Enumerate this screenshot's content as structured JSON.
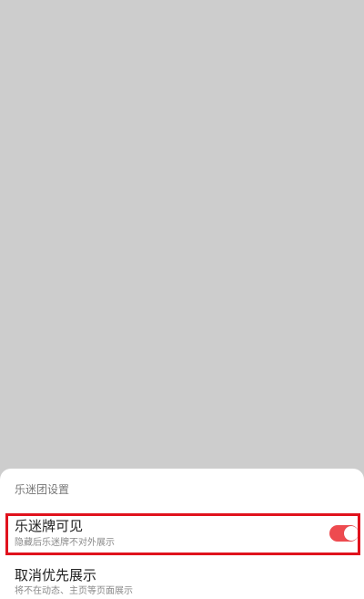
{
  "sheet": {
    "title": "乐迷团设置"
  },
  "settings": [
    {
      "label": "乐迷牌可见",
      "description": "隐藏后乐迷牌不对外展示",
      "toggle": {
        "state": "on",
        "color": "#ee4a4f"
      }
    },
    {
      "label": "取消优先展示",
      "description": "将不在动态、主页等页面展示"
    }
  ],
  "highlight": {
    "color": "#e0121d"
  },
  "background": {
    "overlay_color": "#cdcdcd"
  }
}
